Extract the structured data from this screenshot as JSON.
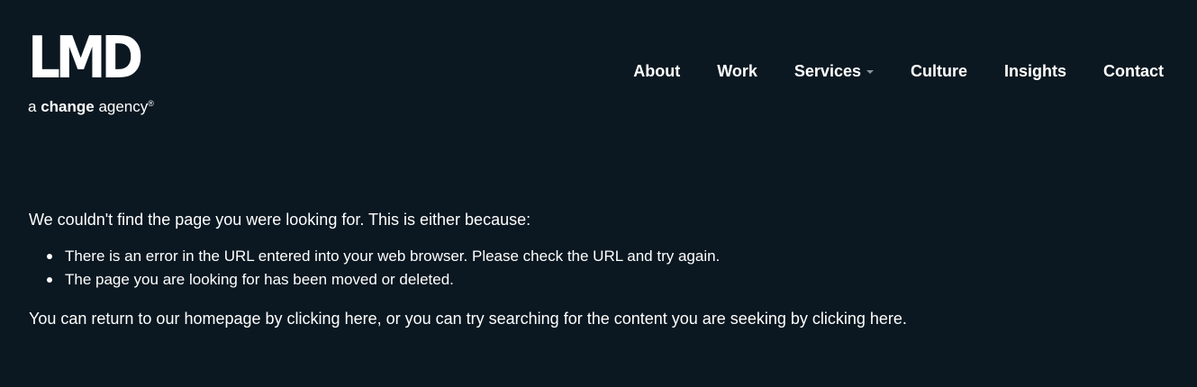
{
  "logo": {
    "mark": "LMD",
    "tagline_prefix": "a ",
    "tagline_bold": "change",
    "tagline_suffix": " agency",
    "registered": "®"
  },
  "nav": {
    "items": [
      {
        "label": "About",
        "has_dropdown": false
      },
      {
        "label": "Work",
        "has_dropdown": false
      },
      {
        "label": "Services",
        "has_dropdown": true
      },
      {
        "label": "Culture",
        "has_dropdown": false
      },
      {
        "label": "Insights",
        "has_dropdown": false
      },
      {
        "label": "Contact",
        "has_dropdown": false
      }
    ]
  },
  "error": {
    "intro": "We couldn't find the page you were looking for. This is either because:",
    "reasons": [
      "There is an error in the URL entered into your web browser. Please check the URL and try again.",
      "The page you are looking for has been moved or deleted."
    ],
    "footer_part1": "You can return to our homepage by ",
    "footer_link1": "clicking here",
    "footer_part2": ", or you can try searching for the content you are seeking by ",
    "footer_link2": "clicking here",
    "footer_part3": "."
  },
  "colors": {
    "background": "#0b1821",
    "text": "#ffffff",
    "caret": "#8a949a"
  },
  "icons": {
    "dropdown": "chevron-down-icon",
    "bullet": "bullet-icon"
  }
}
